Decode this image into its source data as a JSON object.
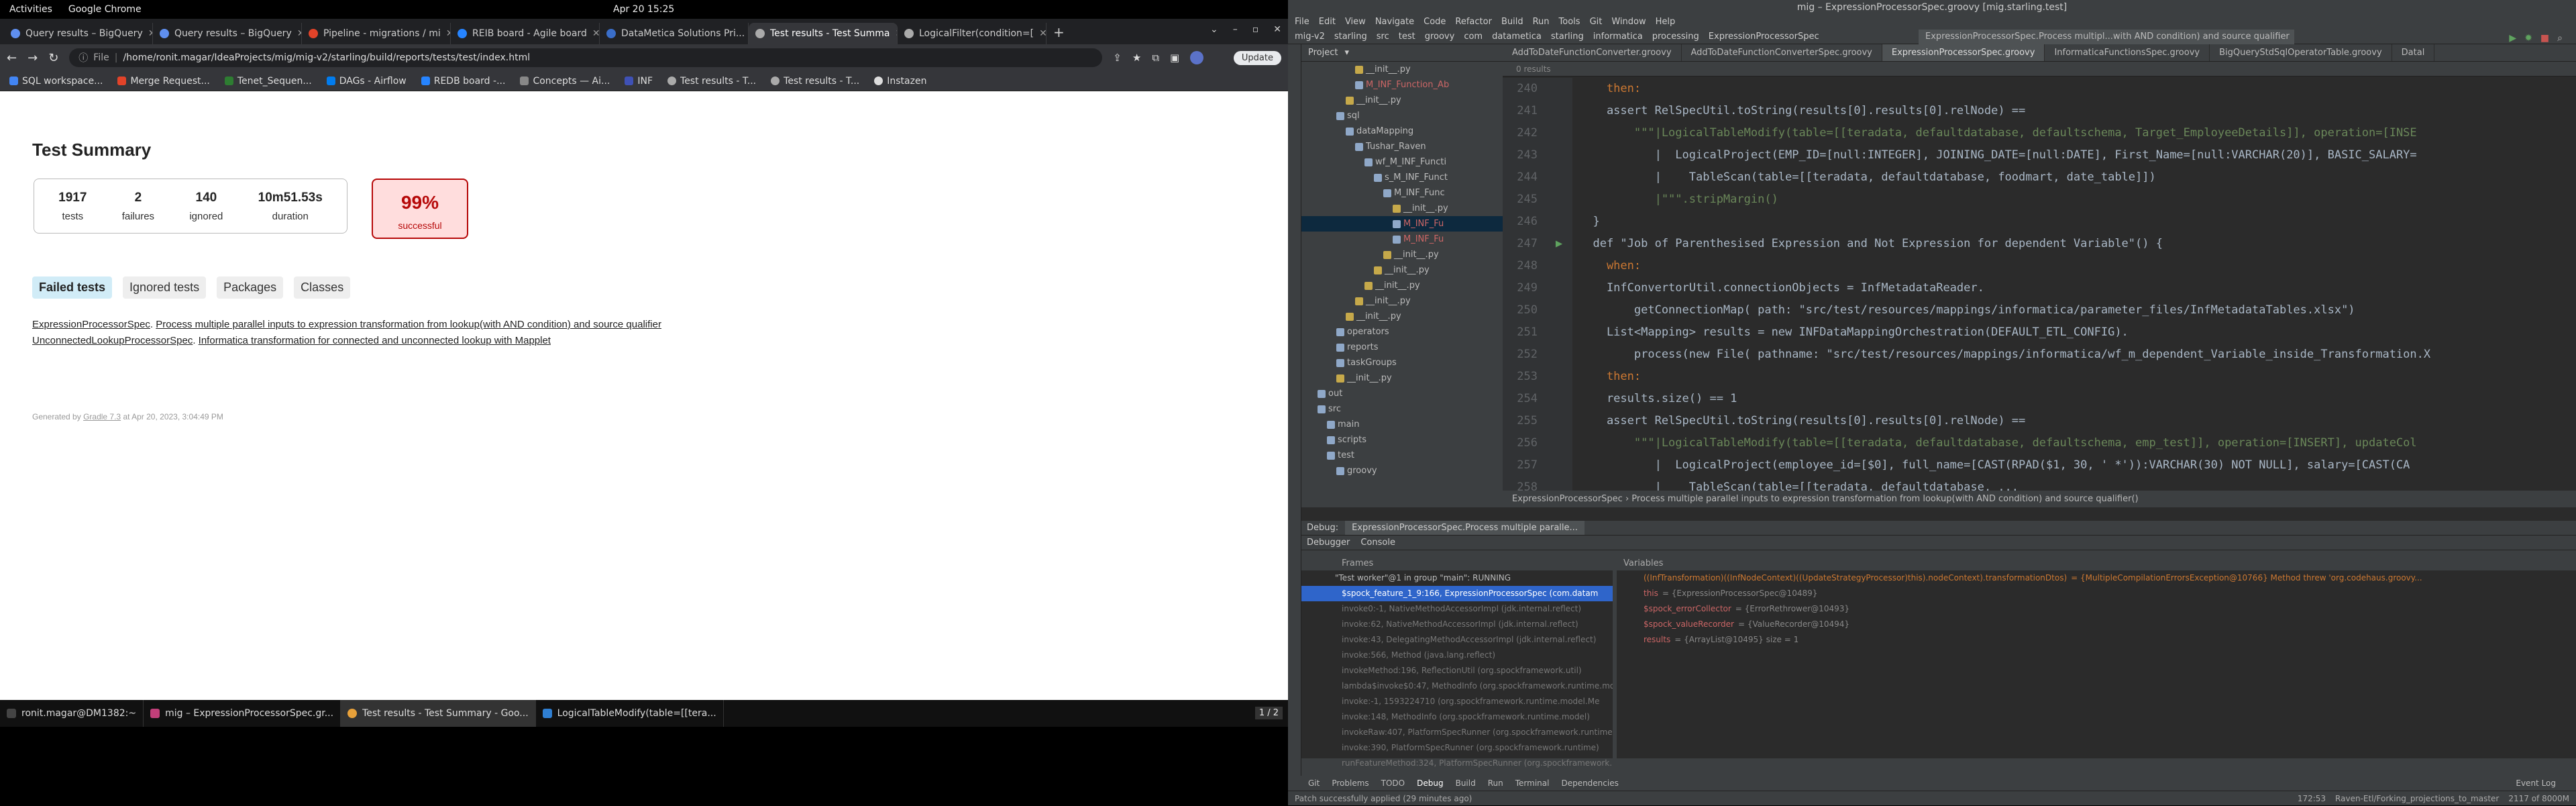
{
  "system": {
    "activities": "Activities",
    "app": "Google Chrome",
    "clock": "Apr 20  15:25"
  },
  "chrome": {
    "tabs": [
      {
        "label": "Query results – BigQuery"
      },
      {
        "label": "Query results – BigQuery"
      },
      {
        "label": "Pipeline - migrations / mi"
      },
      {
        "label": "REIB board - Agile board"
      },
      {
        "label": "DataMetica Solutions Pri..."
      },
      {
        "label": "Test results - Test Summa"
      },
      {
        "label": "LogicalFilter(condition=[ "
      }
    ],
    "url_prefix": "File",
    "url": "/home/ronit.magar/IdeaProjects/mig/mig-v2/starling/build/reports/tests/test/index.html",
    "update_label": "Update",
    "bookmarks": [
      "SQL workspace...",
      "Merge Request...",
      "Tenet_Sequen...",
      "DAGs - Airflow",
      "REDB board -...",
      "Concepts — Ai...",
      "INF",
      "Test results - T...",
      "Test results - T...",
      "Instazen"
    ]
  },
  "report": {
    "title": "Test Summary",
    "stats": [
      {
        "value": "1917",
        "label": "tests"
      },
      {
        "value": "2",
        "label": "failures"
      },
      {
        "value": "140",
        "label": "ignored"
      },
      {
        "value": "10m51.53s",
        "label": "duration"
      }
    ],
    "success": {
      "value": "99%",
      "label": "successful"
    },
    "tabs": [
      "Failed tests",
      "Ignored tests",
      "Packages",
      "Classes"
    ],
    "failed": [
      {
        "cls": "ExpressionProcessorSpec",
        "test": "Process multiple parallel inputs to expression transformation from lookup(with AND condition) and source qualifier"
      },
      {
        "cls": "UnconnectedLookupProcessorSpec",
        "test": "Informatica transformation for connected and unconnected lookup with Mapplet"
      }
    ],
    "footer_prefix": "Generated by ",
    "footer_link": "Gradle 7.3",
    "footer_suffix": " at Apr 20, 2023, 3:04:49 PM"
  },
  "taskbar": {
    "items": [
      "ronit.magar@DM1382:~",
      "mig – ExpressionProcessorSpec.gr...",
      "Test results - Test Summary - Goo...",
      "LogicalTableModify(table=[[tera..."
    ],
    "pager": "1 / 2"
  },
  "ide": {
    "title": "mig – ExpressionProcessorSpec.groovy [mig.starling.test]",
    "menu": [
      "File",
      "Edit",
      "View",
      "Navigate",
      "Code",
      "Refactor",
      "Build",
      "Run",
      "Tools",
      "Git",
      "Window",
      "Help"
    ],
    "nav": [
      "mig-v2",
      "starling",
      "src",
      "test",
      "groovy",
      "com",
      "datametica",
      "starling",
      "informatica",
      "processing",
      "ExpressionProcessorSpec"
    ],
    "run_config": "ExpressionProcessorSpec.Process multipl...with AND condition) and source qualifier",
    "project_label": "Project",
    "tree": [
      {
        "t": "__init__.py",
        "py": true,
        "d": 5
      },
      {
        "t": "M_INF_Function_Ab",
        "red": true,
        "d": 5
      },
      {
        "t": "__init__.py",
        "py": true,
        "d": 4
      },
      {
        "t": "sql",
        "d": 3
      },
      {
        "t": "dataMapping",
        "d": 4
      },
      {
        "t": "Tushar_Raven",
        "d": 5
      },
      {
        "t": "wf_M_INF_Functi",
        "d": 6
      },
      {
        "t": "s_M_INF_Funct",
        "d": 7
      },
      {
        "t": "M_INF_Func",
        "d": 8
      },
      {
        "t": "__init__.py",
        "py": true,
        "d": 9
      },
      {
        "t": "M_INF_Fu",
        "red": true,
        "d": 9,
        "sel": true
      },
      {
        "t": "M_INF_Fu",
        "red": true,
        "d": 9
      },
      {
        "t": "__init__.py",
        "py": true,
        "d": 8
      },
      {
        "t": "__init__.py",
        "py": true,
        "d": 7
      },
      {
        "t": "__init__.py",
        "py": true,
        "d": 6
      },
      {
        "t": "__init__.py",
        "py": true,
        "d": 5
      },
      {
        "t": "__init__.py",
        "py": true,
        "d": 4
      },
      {
        "t": "operators",
        "d": 3
      },
      {
        "t": "reports",
        "d": 3
      },
      {
        "t": "taskGroups",
        "d": 3
      },
      {
        "t": "__init__.py",
        "py": true,
        "d": 3
      },
      {
        "t": "out",
        "d": 1
      },
      {
        "t": "src",
        "d": 1
      },
      {
        "t": "main",
        "d": 2
      },
      {
        "t": "scripts",
        "d": 2
      },
      {
        "t": "test",
        "d": 2
      },
      {
        "t": "groovy",
        "d": 3
      }
    ],
    "editor_tabs": [
      "AddToDateFunctionConverter.groovy",
      "AddToDateFunctionConverterSpec.groovy",
      "ExpressionProcessorSpec.groovy",
      "InformaticaFunctionsSpec.groovy",
      "BigQueryStdSqlOperatorTable.groovy",
      "Datal"
    ],
    "find_text": "0 results",
    "lines": [
      {
        "n": "240",
        "c": "    then:"
      },
      {
        "n": "241",
        "c": "    assert RelSpecUtil.toString(results[0].results[0].relNode) =="
      },
      {
        "n": "242",
        "c": "        \"\"\"|LogicalTableModify(table=[[teradata, defaultdatabase, defaultschema, Target_EmployeeDetails]], operation=[INSE"
      },
      {
        "n": "243",
        "c": "           |  LogicalProject(EMP_ID=[null:INTEGER], JOINING_DATE=[null:DATE], First_Name=[null:VARCHAR(20)], BASIC_SALARY="
      },
      {
        "n": "244",
        "c": "           |    TableScan(table=[[teradata, defaultdatabase, foodmart, date_table]])"
      },
      {
        "n": "245",
        "c": "           |\"\"\".stripMargin()"
      },
      {
        "n": "246",
        "c": "  }"
      },
      {
        "n": "247",
        "c": "  def \"Job of Parenthesised Expression and Not Expression for dependent Variable\"() {"
      },
      {
        "n": "248",
        "c": "    when:"
      },
      {
        "n": "249",
        "c": "    InfConvertorUtil.connectionObjects = InfMetadataReader."
      },
      {
        "n": "250",
        "c": "        getConnectionMap( path: \"src/test/resources/mappings/informatica/parameter_files/InfMetadataTables.xlsx\")"
      },
      {
        "n": "251",
        "c": "    List<Mapping> results = new INFDataMappingOrchestration(DEFAULT_ETL_CONFIG)."
      },
      {
        "n": "252",
        "c": "        process(new File( pathname: \"src/test/resources/mappings/informatica/wf_m_dependent_Variable_inside_Transformation.X"
      },
      {
        "n": "253",
        "c": "    then:"
      },
      {
        "n": "254",
        "c": "    results.size() == 1"
      },
      {
        "n": "255",
        "c": "    assert RelSpecUtil.toString(results[0].results[0].relNode) =="
      },
      {
        "n": "256",
        "c": "        \"\"\"|LogicalTableModify(table=[[teradata, defaultdatabase, defaultschema, emp_test]], operation=[INSERT], updateCol"
      },
      {
        "n": "257",
        "c": "           |  LogicalProject(employee_id=[$0], full_name=[CAST(RPAD($1, 30, ' *')):VARCHAR(30) NOT NULL], salary=[CAST(CA"
      },
      {
        "n": "258",
        "c": "           |    TableScan(table=[[teradata, defaultdatabase, ..."
      }
    ],
    "breadcrumb": "ExpressionProcessorSpec  ›  Process multiple parallel inputs to expression transformation from lookup(with AND condition) and source qualifier()",
    "debug": {
      "label": "Debug:",
      "session": "ExpressionProcessorSpec.Process multiple paralle...",
      "debugger": "Debugger",
      "console": "Console",
      "frames": "Frames",
      "variables": "Variables",
      "thread": "\"Test worker\"@1 in group \"main\": RUNNING",
      "frame_list": [
        "$spock_feature_1_9:166, ExpressionProcessorSpec (com.datam",
        "invoke0:-1, NativeMethodAccessorImpl (jdk.internal.reflect)",
        "invoke:62, NativeMethodAccessorImpl (jdk.internal.reflect)",
        "invoke:43, DelegatingMethodAccessorImpl (jdk.internal.reflect)",
        "invoke:566, Method (java.lang.reflect)",
        "invokeMethod:196, ReflectionUtil (org.spockframework.util)",
        "lambda$invoke$0:47, MethodInfo (org.spockframework.runtime.mo",
        "invoke:-1, 1593224710 (org.spockframework.runtime.model.Me",
        "invoke:148, MethodInfo (org.spockframework.runtime.model)",
        "invokeRaw:407, PlatformSpecRunner (org.spockframework.runtime)",
        "invoke:390, PlatformSpecRunner (org.spockframework.runtime)",
        "runFeatureMethod:324, PlatformSpecRunner (org.spockframework.r"
      ],
      "vars": [
        {
          "name": "((InfTransformation)((InfNodeContext)((UpdateStrategyProcessor)this).nodeContext).transformationDtos)",
          "val": "= {MultipleCompilationErrorsException@10766} Method threw 'org.codehaus.groovy...",
          "err": true
        },
        {
          "name": "this",
          "val": "= {ExpressionProcessorSpec@10489}"
        },
        {
          "name": "$spock_errorCollector",
          "val": "= {ErrorRethrower@10493}"
        },
        {
          "name": "$spock_valueRecorder",
          "val": "= {ValueRecorder@10494}"
        },
        {
          "name": "results",
          "val": "= {ArrayList@10495}  size = 1"
        }
      ]
    },
    "toolwindows": [
      "Git",
      "Problems",
      "TODO",
      "Debug",
      "Build",
      "Run",
      "Terminal",
      "Dependencies"
    ],
    "status_left": "Patch successfully applied (29 minutes ago)",
    "status_pos": "172:53",
    "status_branch": "Raven-Etl/Forking_projections_to_master",
    "status_mem": "2117 of 8000M",
    "event_log": "Event Log"
  }
}
